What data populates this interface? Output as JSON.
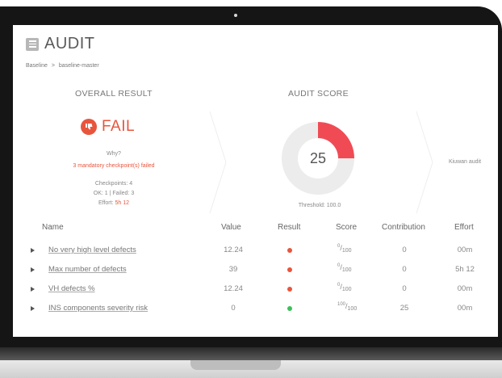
{
  "header": {
    "title": "AUDIT"
  },
  "breadcrumb": {
    "root": "Baseline",
    "separator": ">",
    "current": "baseline-master"
  },
  "overall": {
    "title": "OVERALL RESULT",
    "status": "FAIL",
    "why": "Why?",
    "reason": "3 mandatory checkpoint(s) failed",
    "checkpoints": "Checkpoints: 4",
    "ok_failed": "OK: 1 | Failed: 3",
    "effort_label": "Effort:",
    "effort_value": "5h 12"
  },
  "score": {
    "title": "AUDIT SCORE",
    "value": "25",
    "threshold": "Threshold: 100.0",
    "fraction": 0.25
  },
  "side_label": "Kiuwan audit",
  "table": {
    "headers": {
      "name": "Name",
      "value": "Value",
      "result": "Result",
      "score": "Score",
      "contribution": "Contribution",
      "effort": "Effort"
    },
    "rows": [
      {
        "name": "No very high level defects",
        "value": "12.24",
        "result": "fail",
        "score_num": "0",
        "score_den": "100",
        "contribution": "0",
        "effort": "00m"
      },
      {
        "name": "Max number of defects",
        "value": "39",
        "result": "fail",
        "score_num": "0",
        "score_den": "100",
        "contribution": "0",
        "effort": "5h 12"
      },
      {
        "name": "VH defects %",
        "value": "12.24",
        "result": "fail",
        "score_num": "0",
        "score_den": "100",
        "contribution": "0",
        "effort": "00m"
      },
      {
        "name": "INS components severity risk",
        "value": "0",
        "result": "pass",
        "score_num": "100",
        "score_den": "100",
        "contribution": "25",
        "effort": "00m"
      }
    ]
  },
  "colors": {
    "fail": "#e8553d",
    "pass": "#3cc05a",
    "donut_fill": "#f04b55",
    "donut_track": "#ececec"
  }
}
